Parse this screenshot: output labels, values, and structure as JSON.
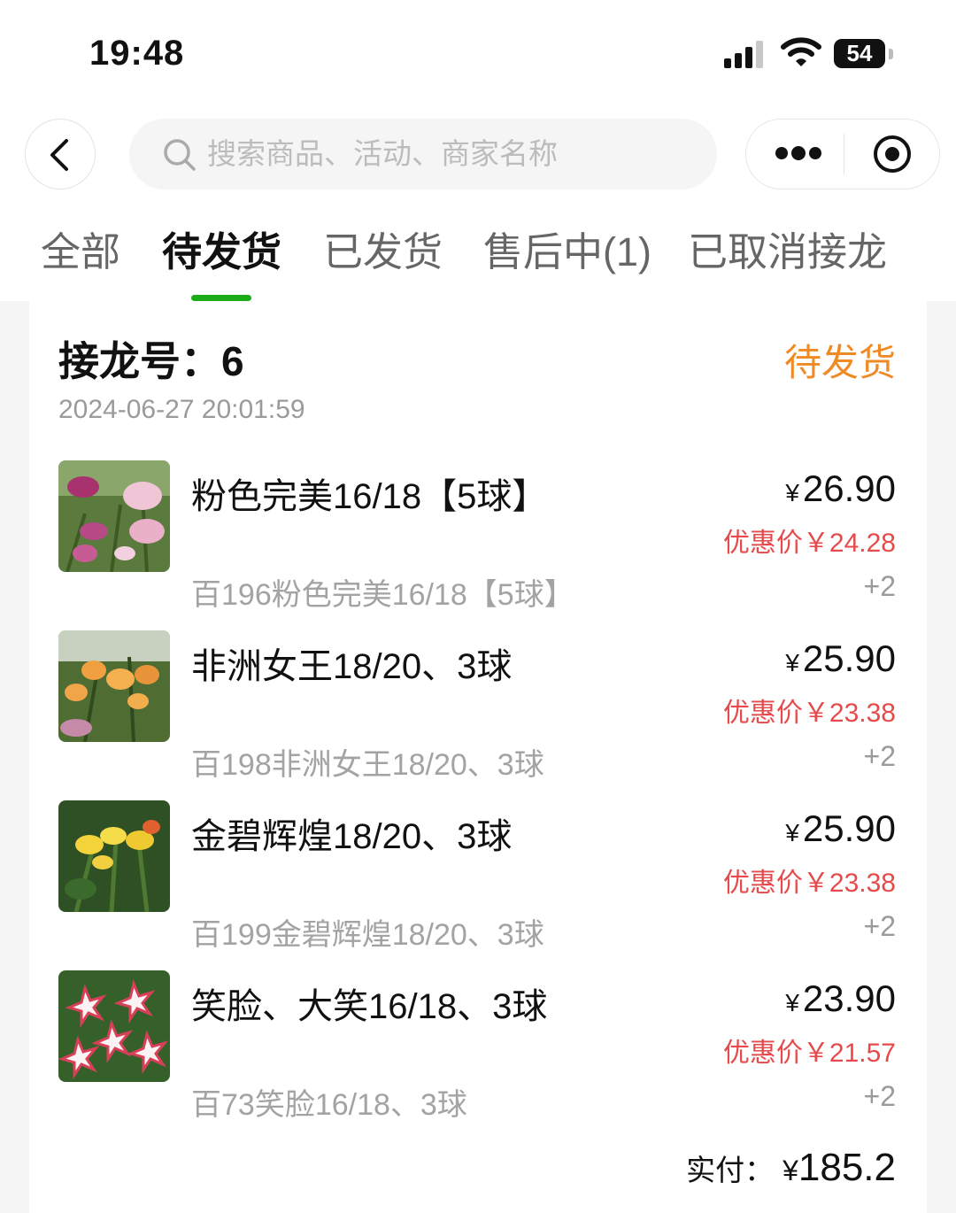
{
  "status_bar": {
    "time": "19:48",
    "battery": "54"
  },
  "search": {
    "placeholder": "搜索商品、活动、商家名称"
  },
  "tabs": [
    {
      "label": "全部"
    },
    {
      "label": "待发货",
      "active": true
    },
    {
      "label": "已发货"
    },
    {
      "label": "售后中(1)"
    },
    {
      "label": "已取消接龙"
    }
  ],
  "order": {
    "number_label": "接龙号：",
    "number": "6",
    "status": "待发货",
    "datetime": "2024-06-27 20:01:59",
    "items": [
      {
        "name": "粉色完美16/18【5球】",
        "price": "26.90",
        "currency": "¥",
        "discount": "优惠价￥24.28",
        "sub": "百196粉色完美16/18【5球】",
        "qty": "+2",
        "image": "pink-lily-icon"
      },
      {
        "name": "非洲女王18/20、3球",
        "price": "25.90",
        "currency": "¥",
        "discount": "优惠价￥23.38",
        "sub": "百198非洲女王18/20、3球",
        "qty": "+2",
        "image": "orange-lily-icon"
      },
      {
        "name": "金碧辉煌18/20、3球",
        "price": "25.90",
        "currency": "¥",
        "discount": "优惠价￥23.38",
        "sub": "百199金碧辉煌18/20、3球",
        "qty": "+2",
        "image": "yellow-lily-icon"
      },
      {
        "name": "笑脸、大笑16/18、3球",
        "price": "23.90",
        "currency": "¥",
        "discount": "优惠价￥21.57",
        "sub": "百73笑脸16/18、3球",
        "qty": "+2",
        "image": "white-red-lily-icon"
      }
    ],
    "total_label": "实付：",
    "total_currency": "¥",
    "total": "185.2"
  },
  "colors": {
    "accent_green": "#1aad19",
    "status_orange": "#f08a24",
    "discount_red": "#e64a4a"
  }
}
